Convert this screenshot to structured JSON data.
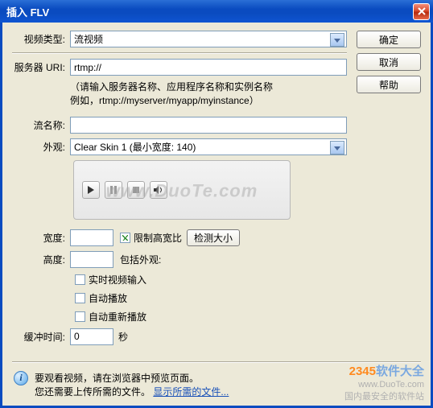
{
  "window": {
    "title": "插入 FLV"
  },
  "buttons": {
    "ok": "确定",
    "cancel": "取消",
    "help": "帮助",
    "detect_size": "检测大小"
  },
  "labels": {
    "video_type": "视频类型:",
    "server_uri": "服务器 URI:",
    "stream_name": "流名称:",
    "skin": "外观:",
    "width": "宽度:",
    "height": "高度:",
    "buffer_time": "缓冲时间:",
    "seconds": "秒",
    "include_skin": "包括外观:",
    "constrain": "限制高宽比",
    "live_input": "实时视频输入",
    "autoplay": "自动播放",
    "auto_rewind": "自动重新播放"
  },
  "values": {
    "video_type": "流视频",
    "server_uri": "rtmp://",
    "stream_name": "",
    "skin": "Clear Skin 1 (最小宽度: 140)",
    "width": "",
    "height": "",
    "buffer_time": "0",
    "constrain_checked": true,
    "live_checked": false,
    "autoplay_checked": false,
    "autorewind_checked": false
  },
  "hint": {
    "line1": "（请输入服务器名称、应用程序名称和实例名称",
    "line2": "例如，rtmp://myserver/myapp/myinstance）"
  },
  "footer": {
    "line1": "要观看视频，请在浏览器中预览页面。",
    "line2_pre": "您还需要上传所需的文件。",
    "link": "显示所需的文件..."
  },
  "watermark": {
    "main": "www.DuoTe.com",
    "brand_num": "2345",
    "brand_text": "软件大全",
    "sub1": "www.DuoTe.com",
    "sub2": "国内最安全的软件站"
  }
}
